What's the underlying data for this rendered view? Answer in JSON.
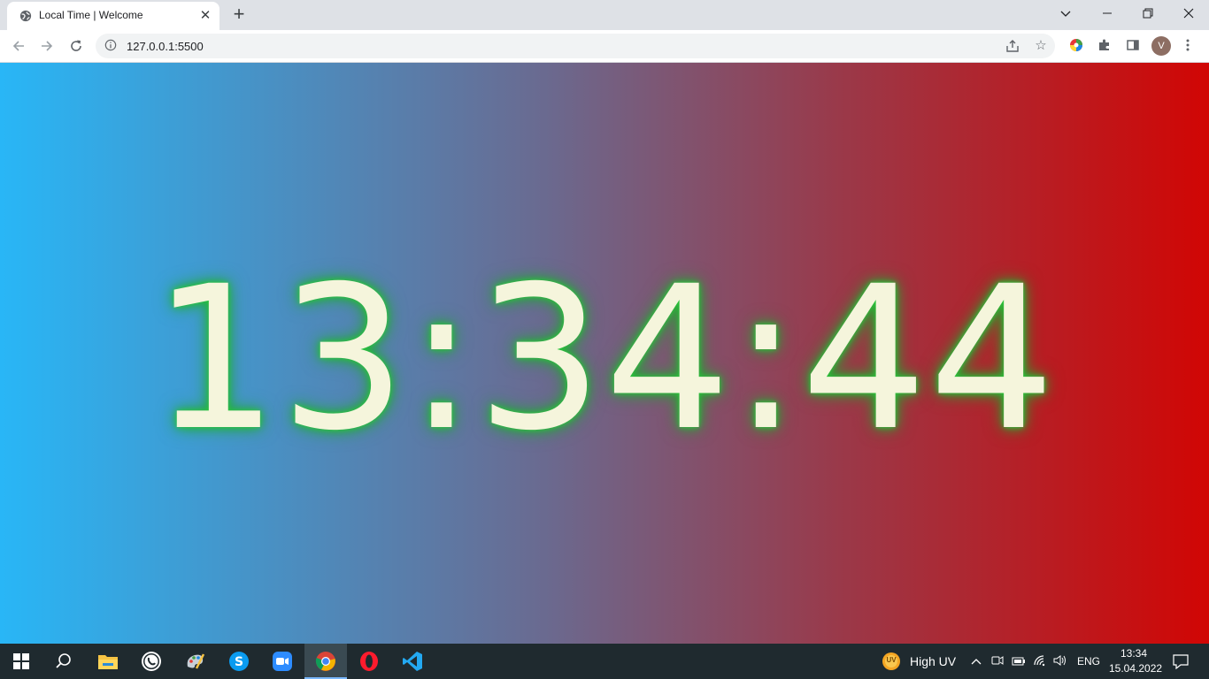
{
  "browser": {
    "tab_title": "Local Time | Welcome",
    "tab_close": "✕",
    "new_tab": "+",
    "url": "127.0.0.1:5500",
    "profile_initial": "V",
    "window_controls": [
      "minimize",
      "restore",
      "close"
    ]
  },
  "page": {
    "clock_time": "13:34:44",
    "gradient_colors": [
      "#29b6f6",
      "#6a6a90",
      "#9b3848",
      "#d10604"
    ],
    "clock_color": "#f5f5dc",
    "glow_color": "#2ecc40"
  },
  "taskbar": {
    "apps": [
      "start-icon",
      "search-icon",
      "file-explorer-icon",
      "whatsapp-icon",
      "paint-icon",
      "skype-icon",
      "zoom-icon",
      "chrome-icon",
      "opera-icon",
      "vscode-icon"
    ],
    "weather_badge": "UV",
    "weather_text": "High UV",
    "language": "ENG",
    "time": "13:34",
    "date": "15.04.2022"
  }
}
